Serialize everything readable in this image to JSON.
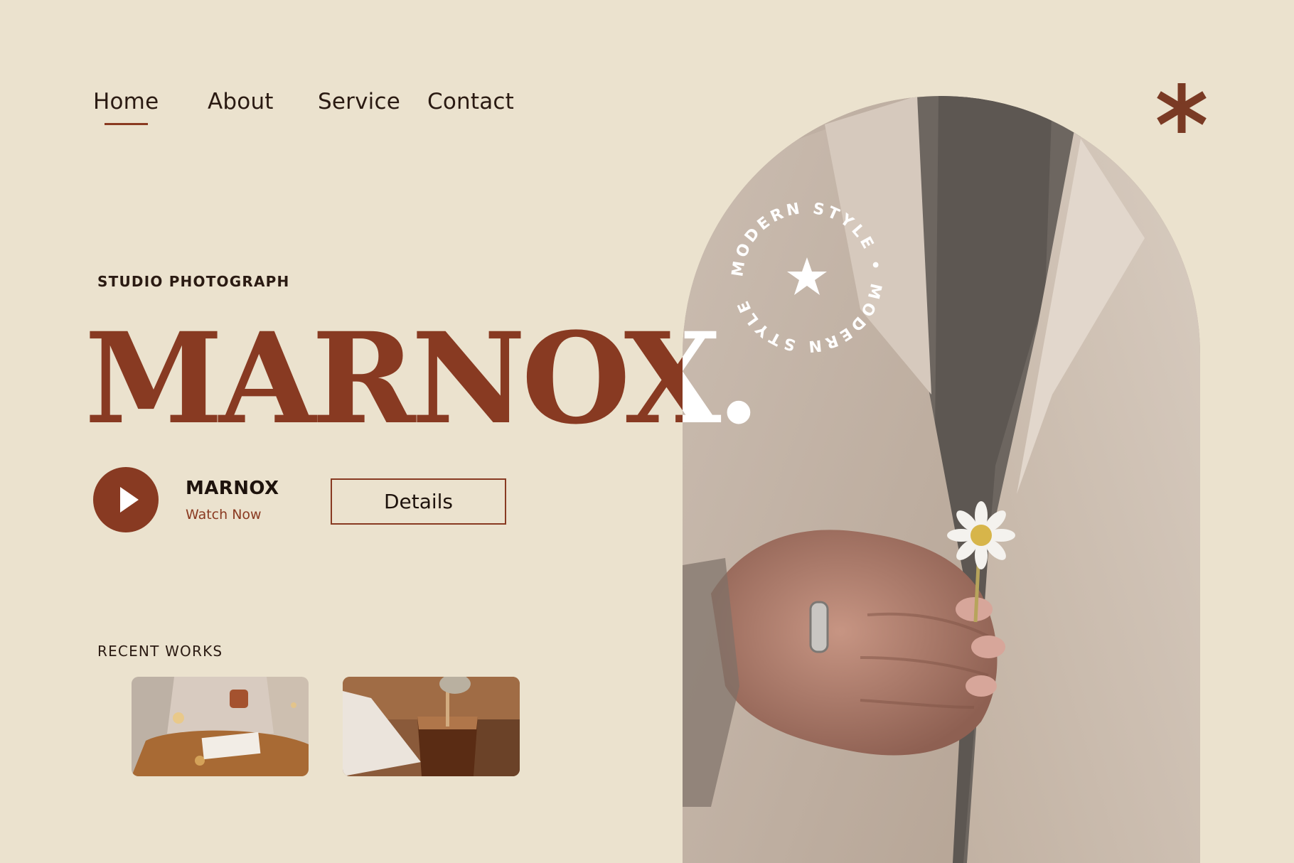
{
  "nav": {
    "items": [
      {
        "label": "Home"
      },
      {
        "label": "About"
      },
      {
        "label": "Service"
      },
      {
        "label": "Contact"
      }
    ],
    "active": "Home"
  },
  "hero": {
    "subtitle": "STUDIO PHOTOGRAPH",
    "brand": "MARNOX.",
    "badge_text": "MODERN STYLE • MODERN STYLE",
    "badge_icon": "star-icon"
  },
  "play": {
    "title": "MARNOX",
    "subtitle": "Watch Now",
    "icon": "play-icon"
  },
  "details_button": {
    "label": "Details"
  },
  "recent_works": {
    "label": "RECENT WORKS",
    "items": [
      {
        "name": "person-reading-with-cup"
      },
      {
        "name": "iced-coffee-pour"
      }
    ]
  },
  "colors": {
    "background": "#ebe2ce",
    "accent": "#883a22",
    "text": "#2a1a12"
  },
  "decor_icon": "asterisk-icon"
}
